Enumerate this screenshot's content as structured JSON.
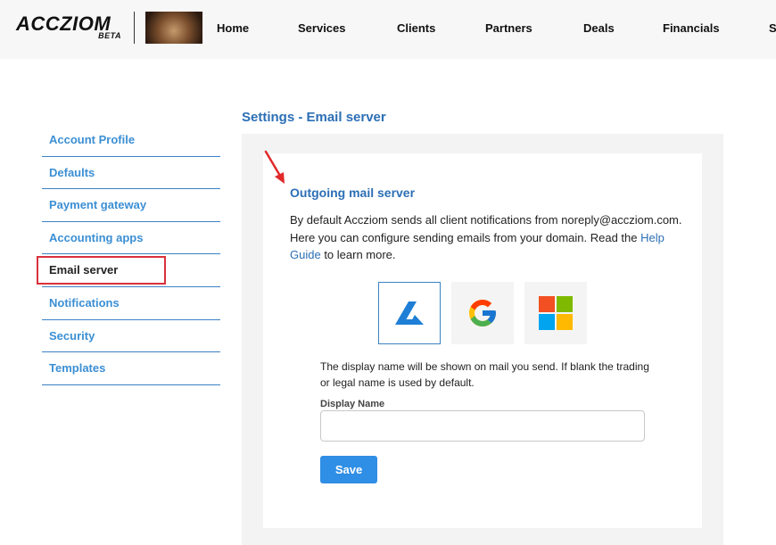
{
  "header": {
    "logo_text": "ACCZIOM",
    "logo_badge": "BETA",
    "avatar_icon": "profile-photo",
    "nav": [
      "Home",
      "Services",
      "Clients",
      "Partners",
      "Deals",
      "Financials",
      "S"
    ]
  },
  "page": {
    "title": "Settings - Email server"
  },
  "sidebar": {
    "items": [
      {
        "label": "Account Profile"
      },
      {
        "label": "Defaults"
      },
      {
        "label": "Payment gateway"
      },
      {
        "label": "Accounting apps"
      },
      {
        "label": "Email server",
        "active": true
      },
      {
        "label": "Notifications"
      },
      {
        "label": "Security"
      },
      {
        "label": "Templates"
      }
    ]
  },
  "content": {
    "section_title": "Outgoing mail server",
    "desc_part1": "By default Accziom sends all client notifications from noreply@accziom.com. Here you can configure sending emails from your domain. Read the ",
    "help_link": "Help Guide",
    "desc_part2": " to learn more.",
    "providers": [
      {
        "icon": "accziom-logo-icon",
        "selected": true
      },
      {
        "icon": "google-logo-icon",
        "selected": false
      },
      {
        "icon": "microsoft-logo-icon",
        "selected": false
      }
    ],
    "note": "The display name will be shown on mail you send. If blank the trading or legal name is used by default.",
    "display_name_label": "Display Name",
    "display_name_value": "",
    "display_name_placeholder": "",
    "save_label": "Save"
  },
  "colors": {
    "accent": "#2c6fb5",
    "link": "#3b8fd4",
    "button": "#2f8ee5",
    "highlight_border": "#d9313c"
  }
}
